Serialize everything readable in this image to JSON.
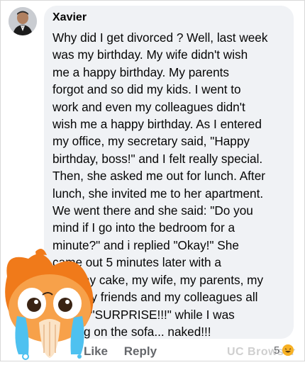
{
  "comment": {
    "author": "Xavier",
    "lines": [
      "Why did I get divorced ? Well, last week",
      "was my birthday. My wife didn't wish",
      "me a happy birthday. My parents",
      "forgot and so did my kids. I went to",
      "work and even my colleagues didn't",
      "wish me a happy birthday. As I entered",
      "my office, my secretary said, \"Happy",
      "birthday, boss!\" and I felt really special.",
      "Then, she asked me out for lunch. After",
      "lunch, she invited me to her apartment.",
      "We went there and she said: \"Do you",
      "mind if I go into the bedroom for a",
      "minute?\" and i replied \"Okay!\" She",
      "came out 5 minutes later with a",
      "birthday cake, my wife, my parents, my",
      "kids, my friends and my colleagues all",
      "yelling \"SURPRISE!!!\" while I was",
      "waiting on the sofa... naked!!!"
    ]
  },
  "actions": {
    "like": "Like",
    "reply": "Reply"
  },
  "reactions": {
    "count": "5",
    "icon": "laughing-emoji-icon"
  },
  "watermark": "UC Browser",
  "colors": {
    "bubble": "#f0f2f5",
    "text": "#050505",
    "meta": "#65676b"
  }
}
